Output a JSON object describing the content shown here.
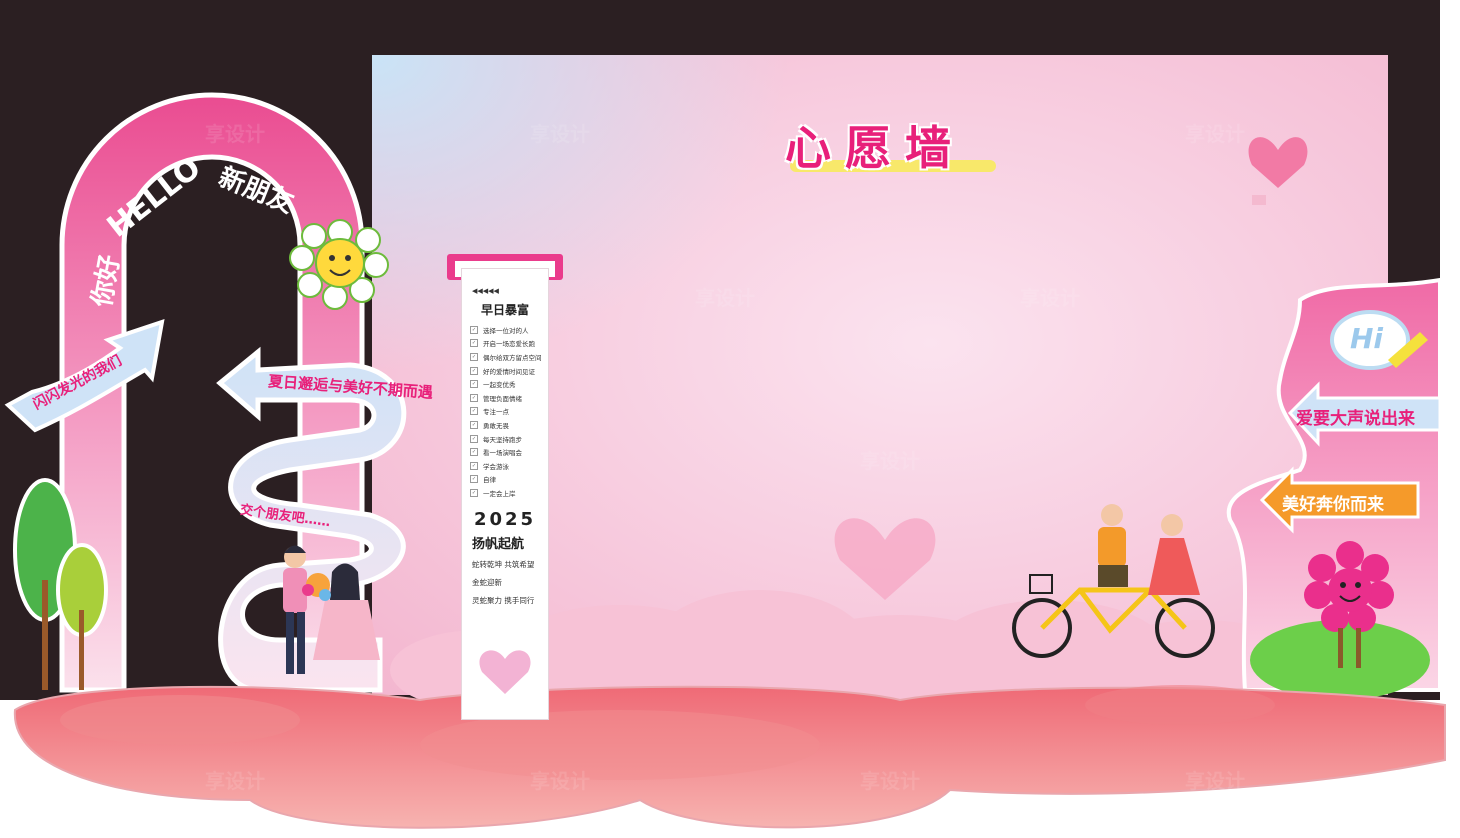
{
  "wall": {
    "title": "心愿墙"
  },
  "arch": {
    "greeting_left": "你好",
    "greeting_mid": "HELLO",
    "greeting_right": "新朋友"
  },
  "left_arrow_sign": {
    "text": "闪闪发光的我们"
  },
  "path_sign": {
    "line1": "夏日邂逅与美好不期而遇",
    "line2": "交个朋友吧……"
  },
  "scroll": {
    "arrows": "◀◀◀◀◀",
    "heading": "早日暴富",
    "checklist": [
      "选择一位对的人",
      "开启一场恋爱长跑",
      "偶尔给双方留点空间",
      "好的爱情时间见证",
      "一起变优秀",
      "管理负面情绪",
      "专注一点",
      "勇敢无畏",
      "每天坚持跑步",
      "看一场演唱会",
      "学会游泳",
      "自律",
      "一定会上岸"
    ],
    "year": "2025",
    "slogan": "扬帆起航",
    "lines": [
      "蛇转乾坤 共筑希望",
      "金蛇迎新",
      "灵蛇聚力 携手同行"
    ]
  },
  "right_panel": {
    "hi_bubble": "Hi",
    "sign1": "爱要大声说出来",
    "sign2": "美好奔你而来"
  },
  "watermark": "享设计",
  "colors": {
    "accent_pink": "#e8207a",
    "arch_pink": "#ea4c91",
    "backdrop": "#2b1f22",
    "floor_red": "#ef6a76",
    "highlight_yellow": "#f8e86a"
  },
  "icons": {
    "flower": "smiling-flower-icon",
    "balloon": "heart-balloon-icon",
    "couple_bike": "couple-on-tandem-bike-illustration",
    "couple_flowers": "couple-with-bouquet-illustration",
    "trees": "tree-icon",
    "mascot": "flower-mascot-icon",
    "heart": "heart-icon",
    "pencil": "pencil-icon"
  }
}
